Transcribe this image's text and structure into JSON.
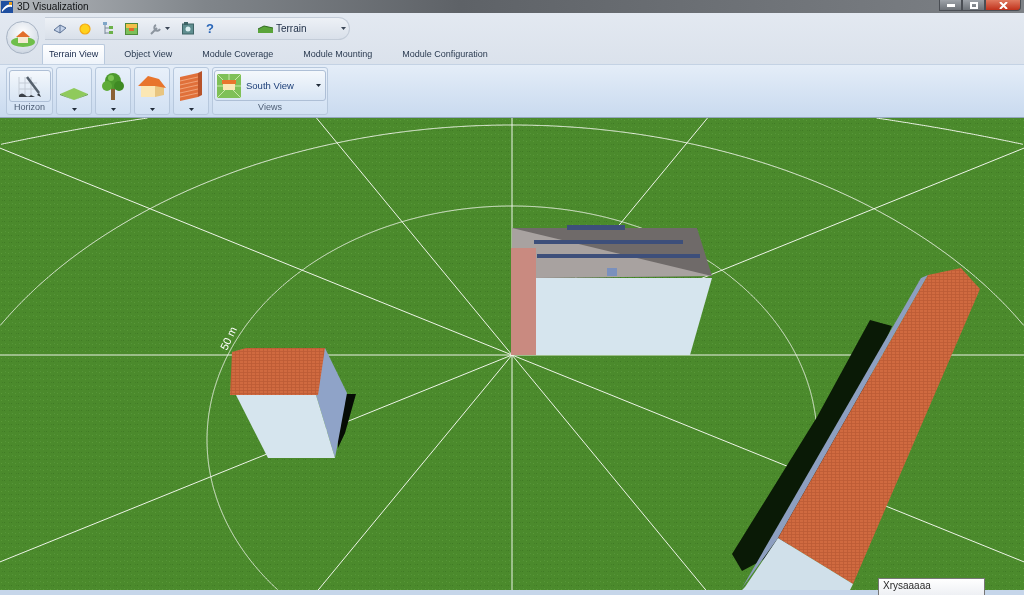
{
  "window": {
    "title": "3D Visualization"
  },
  "quick_access": {
    "help": "?",
    "terrain_dropdown": "Terrain"
  },
  "tabs": [
    {
      "label": "Terrain View",
      "selected": true
    },
    {
      "label": "Object View",
      "selected": false
    },
    {
      "label": "Module Coverage",
      "selected": false
    },
    {
      "label": "Module Mounting",
      "selected": false
    },
    {
      "label": "Module Configuration",
      "selected": false
    }
  ],
  "ribbon": {
    "horizon_group": {
      "label": "Horizon"
    },
    "views_group": {
      "label": "Views",
      "view": "South View"
    }
  },
  "scene": {
    "distance_label": "50 m",
    "tooltip": "Xrysaaaaa"
  }
}
